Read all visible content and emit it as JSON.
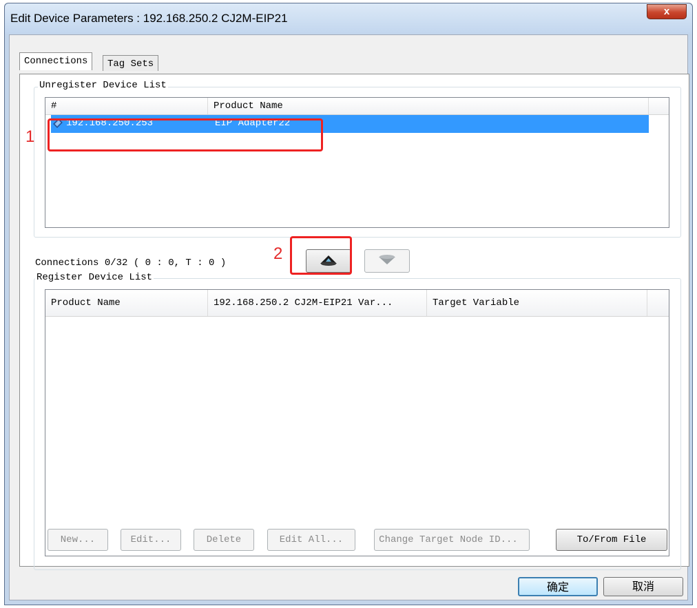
{
  "window": {
    "title": "Edit Device Parameters : 192.168.250.2 CJ2M-EIP21",
    "close_glyph": "x"
  },
  "tabs": [
    {
      "label": "Connections",
      "active": true
    },
    {
      "label": "Tag Sets",
      "active": false
    }
  ],
  "unregister": {
    "group_label": "Unregister Device List",
    "columns": [
      "#",
      "Product Name"
    ],
    "rows": [
      {
        "ip": "192.168.250.253",
        "product": "EIP Adapter22",
        "selected": true,
        "icon": "device-icon"
      }
    ]
  },
  "connections_status": "Connections 0/32 ( 0 : 0, T : 0 )",
  "annotations": {
    "one": "1",
    "two": "2"
  },
  "register": {
    "group_label": "Register Device List",
    "columns": [
      "Product Name",
      "192.168.250.2 CJ2M-EIP21 Var...",
      "Target Variable"
    ]
  },
  "buttons": {
    "register_icon": "register-up-arrow-icon",
    "unregister_icon": "unregister-down-arrow-icon",
    "new": "New...",
    "edit": "Edit...",
    "delete": "Delete",
    "edit_all": "Edit All...",
    "change_target": "Change Target Node ID...",
    "to_from_file": "To/From File",
    "ok": "确定",
    "cancel": "取消"
  },
  "colors": {
    "selection": "#3399ff",
    "annotation_red": "#ee2222",
    "title_bar": "#c2d6ee"
  }
}
